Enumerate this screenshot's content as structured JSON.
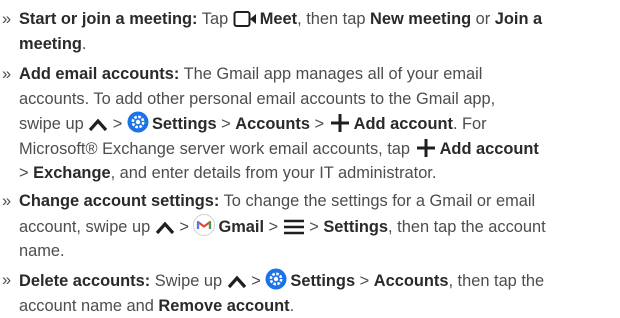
{
  "items": [
    {
      "bullet": "»",
      "lines": [
        [
          "Start or join a meeting:",
          " Tap ",
          "Meet",
          ", then tap ",
          "New meeting",
          " or ",
          "Join a"
        ],
        [
          "meeting",
          "."
        ]
      ]
    },
    {
      "bullet": "»",
      "lines": [
        [
          "Add email accounts:",
          " The Gmail app manages all of your email"
        ],
        [
          "accounts. To add other personal email accounts to the Gmail app,"
        ],
        [
          "swipe up ",
          " > ",
          "Settings",
          " > ",
          "Accounts",
          " > ",
          "Add account",
          ". For"
        ],
        [
          "Microsoft® Exchange server work email accounts, tap ",
          "Add account"
        ],
        [
          "> ",
          "Exchange",
          ", and enter details from your IT administrator."
        ]
      ]
    },
    {
      "bullet": "»",
      "lines": [
        [
          "Change account settings:",
          " To change the settings for a Gmail or email"
        ],
        [
          "account, swipe up ",
          " > ",
          "Gmail",
          " > ",
          " > ",
          "Settings",
          ", then tap the account"
        ],
        [
          "name."
        ]
      ]
    },
    {
      "bullet": "»",
      "lines": [
        [
          "Delete accounts:",
          " Swipe up ",
          " > ",
          "Settings",
          " > ",
          "Accounts",
          ", then tap the"
        ],
        [
          "account name and ",
          "Remove account",
          "."
        ]
      ]
    }
  ],
  "icons": {
    "meet": "video-camera-icon",
    "swipe_up": "chevron-up-icon",
    "settings": "gear-icon",
    "add": "plus-icon",
    "gmail": "gmail-icon",
    "menu": "hamburger-menu-icon"
  },
  "colors": {
    "text": "#4d4d4d",
    "bold": "#2a2a2a",
    "settings_blue": "#1a73e8"
  }
}
